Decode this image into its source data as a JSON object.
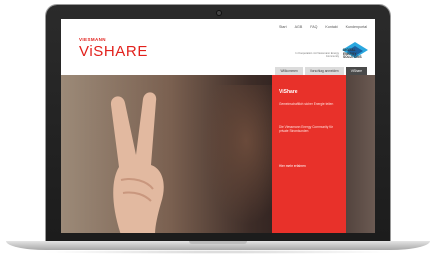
{
  "nav": {
    "items": [
      "Start",
      "AGB",
      "FAQ",
      "Kontakt",
      "Kundenportal"
    ]
  },
  "brand": {
    "small": "VIESMANN",
    "big": "ViSHARE",
    "color": "#e2211c"
  },
  "partner": {
    "text": "In Kooperation mit Viessmann Energy Community",
    "name_lines": [
      "DIGITAL",
      "ENERGY",
      "SOLUTIONS"
    ]
  },
  "tabs": [
    {
      "label": "Willkommen",
      "active": false
    },
    {
      "label": "Vorschlag anmelden",
      "active": false
    },
    {
      "label": "ViShare",
      "active": true
    }
  ],
  "panel": {
    "title": "ViShare",
    "text1": "Gemeinschaftlich sicher Energie teilen",
    "text2": "Die Viessmann Energy Community für private Stromkunden",
    "link": "Hier mehr erfahren",
    "color": "#e8312a"
  }
}
